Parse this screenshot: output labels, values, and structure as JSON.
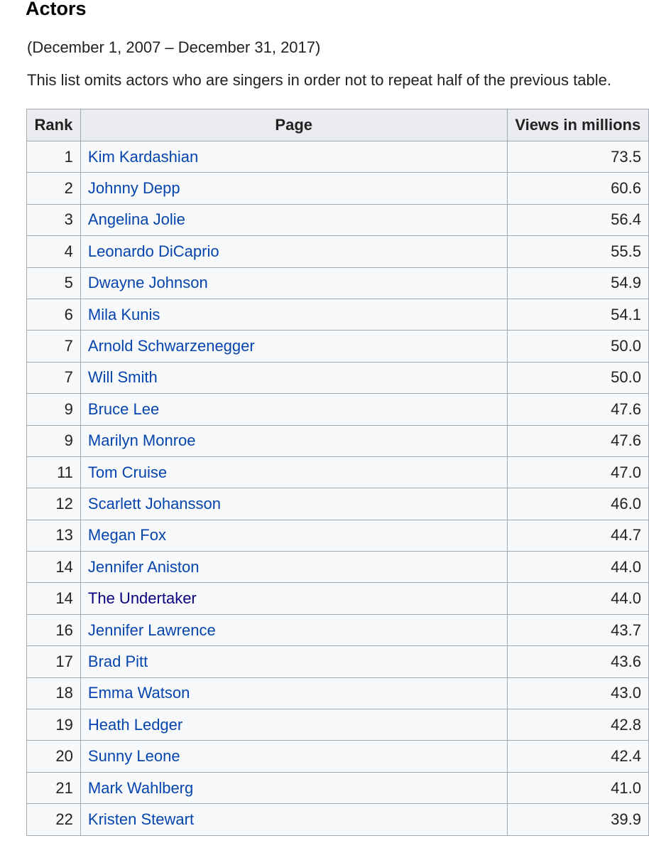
{
  "section": {
    "title": "Actors",
    "date_range": "(December 1, 2007 – December 31, 2017)",
    "note": "This list omits actors who are singers in order not to repeat half of the previous table."
  },
  "table": {
    "headers": [
      "Rank",
      "Page",
      "Views in millions"
    ],
    "rows": [
      {
        "rank": "1",
        "page": "Kim Kardashian",
        "views": "73.5"
      },
      {
        "rank": "2",
        "page": "Johnny Depp",
        "views": "60.6"
      },
      {
        "rank": "3",
        "page": "Angelina Jolie",
        "views": "56.4"
      },
      {
        "rank": "4",
        "page": "Leonardo DiCaprio",
        "views": "55.5"
      },
      {
        "rank": "5",
        "page": "Dwayne Johnson",
        "views": "54.9"
      },
      {
        "rank": "6",
        "page": "Mila Kunis",
        "views": "54.1"
      },
      {
        "rank": "7",
        "page": "Arnold Schwarzenegger",
        "views": "50.0"
      },
      {
        "rank": "7",
        "page": "Will Smith",
        "views": "50.0"
      },
      {
        "rank": "9",
        "page": "Bruce Lee",
        "views": "47.6"
      },
      {
        "rank": "9",
        "page": "Marilyn Monroe",
        "views": "47.6"
      },
      {
        "rank": "11",
        "page": "Tom Cruise",
        "views": "47.0"
      },
      {
        "rank": "12",
        "page": "Scarlett Johansson",
        "views": "46.0"
      },
      {
        "rank": "13",
        "page": "Megan Fox",
        "views": "44.7"
      },
      {
        "rank": "14",
        "page": "Jennifer Aniston",
        "views": "44.0"
      },
      {
        "rank": "14",
        "page": "The Undertaker",
        "views": "44.0",
        "visited": true
      },
      {
        "rank": "16",
        "page": "Jennifer Lawrence",
        "views": "43.7"
      },
      {
        "rank": "17",
        "page": "Brad Pitt",
        "views": "43.6"
      },
      {
        "rank": "18",
        "page": "Emma Watson",
        "views": "43.0"
      },
      {
        "rank": "19",
        "page": "Heath Ledger",
        "views": "42.8"
      },
      {
        "rank": "20",
        "page": "Sunny Leone",
        "views": "42.4"
      },
      {
        "rank": "21",
        "page": "Mark Wahlberg",
        "views": "41.0"
      },
      {
        "rank": "22",
        "page": "Kristen Stewart",
        "views": "39.9"
      }
    ]
  },
  "colors": {
    "link": "#0645ad",
    "visited_link": "#0b0080",
    "header_bg": "#eaecf0",
    "cell_bg": "#f8f9fa",
    "border": "#a2a9b1"
  }
}
